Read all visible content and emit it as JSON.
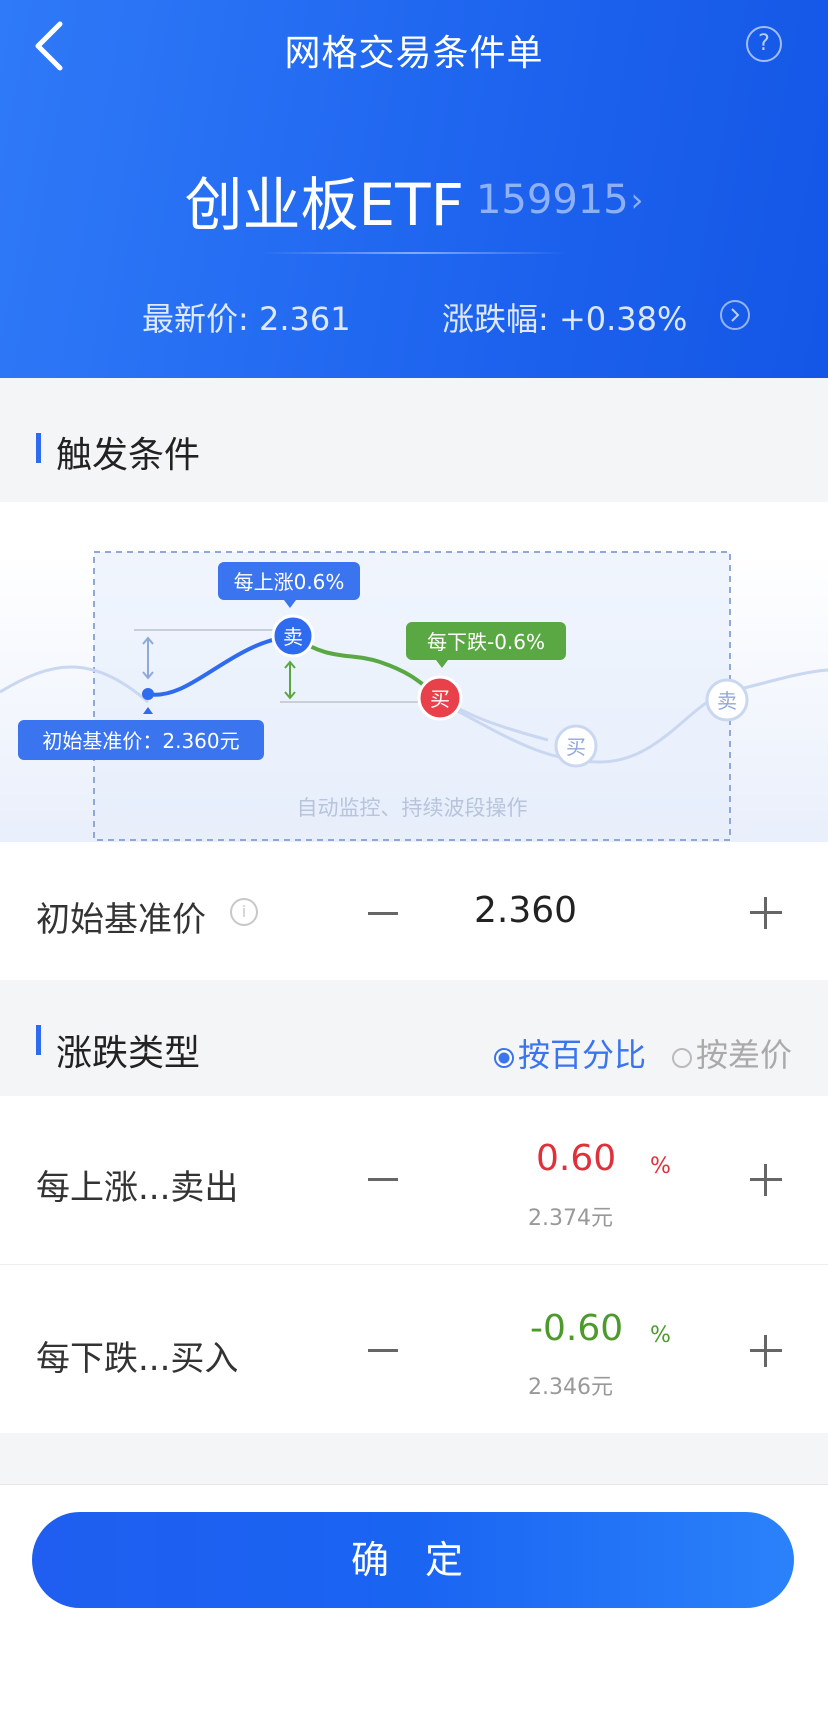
{
  "header": {
    "title": "网格交易条件单",
    "help_label": "?",
    "stock_name": "创业板ETF",
    "stock_code": "159915",
    "latest_price": "最新价: 2.361",
    "change_pct": "涨跌幅: +0.38%"
  },
  "trigger": {
    "title": "触发条件",
    "diagram": {
      "rise_tag": "每上涨0.6%",
      "fall_tag": "每下跌-0.6%",
      "base_tag": "初始基准价：2.360元",
      "sell_label": "卖",
      "buy_label": "买",
      "caption": "自动监控、持续波段操作"
    }
  },
  "base_price": {
    "label": "初始基准价",
    "info_icon": "i",
    "value": "2.360"
  },
  "change_type": {
    "title": "涨跌类型",
    "options": [
      {
        "label": "按百分比",
        "selected": true
      },
      {
        "label": "按差价",
        "selected": false
      }
    ]
  },
  "rise_sell": {
    "label": "每上涨...卖出",
    "value": "0.60",
    "unit": "%",
    "price": "2.374元"
  },
  "fall_buy": {
    "label": "每下跌...买入",
    "value": "-0.60",
    "unit": "%",
    "price": "2.346元"
  },
  "confirm_label": "确 定",
  "colors": {
    "primary": "#2f6bef",
    "up": "#e0303a",
    "down": "#4d9a2c",
    "selected": "#3a74ee"
  }
}
